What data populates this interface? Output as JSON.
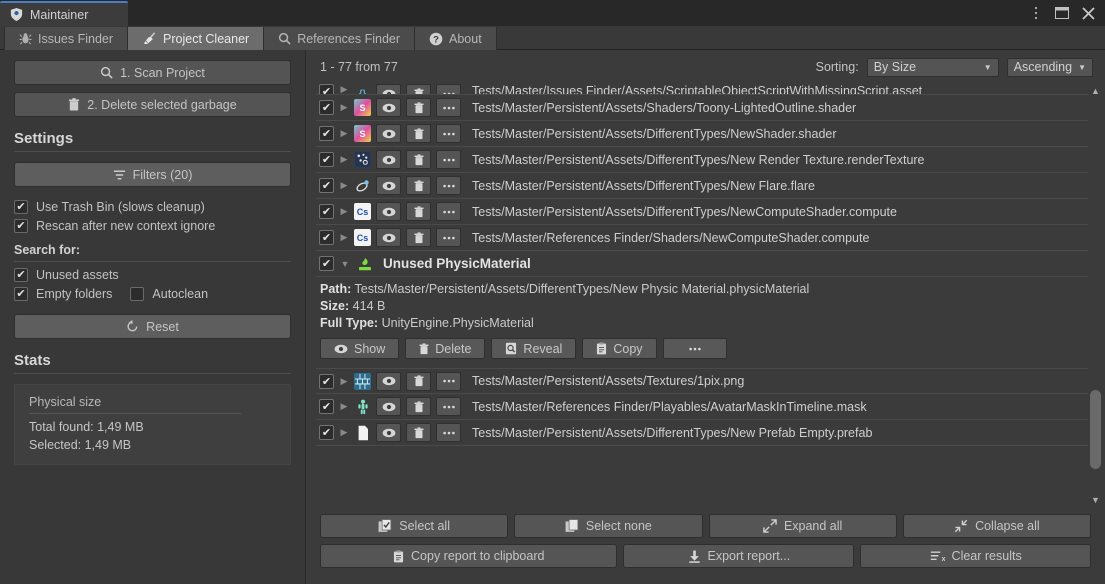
{
  "window": {
    "tab_title": "Maintainer",
    "controls": [
      {
        "name": "menu-icon",
        "glyph": "⋮"
      },
      {
        "name": "maximize-icon",
        "glyph": "❐"
      },
      {
        "name": "close-icon",
        "glyph": "✕"
      }
    ]
  },
  "toolbar": {
    "tabs": [
      {
        "label": "Issues Finder",
        "icon": "bug-icon",
        "active": false
      },
      {
        "label": "Project Cleaner",
        "icon": "broom-icon",
        "active": true
      },
      {
        "label": "References Finder",
        "icon": "search-icon",
        "active": false
      },
      {
        "label": "About",
        "icon": "question-icon",
        "active": false
      }
    ]
  },
  "sidebar": {
    "scan_button": "1. Scan Project",
    "delete_button": "2. Delete selected garbage",
    "settings_header": "Settings",
    "filters_button": "Filters (20)",
    "options": [
      {
        "label": "Use Trash Bin (slows cleanup)",
        "checked": true
      },
      {
        "label": "Rescan after new context ignore",
        "checked": true
      }
    ],
    "search_for_header": "Search for:",
    "search_options": [
      {
        "label": "Unused assets",
        "checked": true
      },
      {
        "label": "Empty folders",
        "checked": true
      },
      {
        "label": "Autoclean",
        "checked": false
      }
    ],
    "reset_button": "Reset",
    "stats_header": "Stats",
    "stats": {
      "title": "Physical size",
      "total_found": "Total found: 1,49 MB",
      "selected": "Selected: 1,49 MB"
    }
  },
  "results": {
    "count_label": "1 - 77 from 77",
    "sorting_label": "Sorting:",
    "sort_by": "By Size",
    "sort_order": "Ascending",
    "rows_top": [
      {
        "path": "Tests/Master/Issues Finder/Assets/ScriptableObjectScriptWithMissingScript.asset",
        "icon": "scriptable-object-icon",
        "icon_color": "#4aa3c8",
        "icon_text": "{}",
        "checked": true,
        "clipped": true
      },
      {
        "path": "Tests/Master/Persistent/Assets/Shaders/Toony-LightedOutline.shader",
        "icon": "shader-icon",
        "icon_color": "#7f4fb0",
        "icon_text": "S",
        "checked": true
      },
      {
        "path": "Tests/Master/Persistent/Assets/DifferentTypes/NewShader.shader",
        "icon": "shader-icon",
        "icon_color": "#7f4fb0",
        "icon_text": "S",
        "checked": true
      },
      {
        "path": "Tests/Master/Persistent/Assets/DifferentTypes/New Render Texture.renderTexture",
        "icon": "render-texture-icon",
        "icon_color": "#2a3a55",
        "icon_text": "▚",
        "checked": true
      },
      {
        "path": "Tests/Master/Persistent/Assets/DifferentTypes/New Flare.flare",
        "icon": "flare-icon",
        "icon_color": "#3b3b3b",
        "icon_text": "✦",
        "checked": true
      },
      {
        "path": "Tests/Master/Persistent/Assets/DifferentTypes/NewComputeShader.compute",
        "icon": "compute-shader-icon",
        "icon_color": "#f2f2f2",
        "icon_text": "Cs",
        "checked": true
      },
      {
        "path": "Tests/Master/References Finder/Shaders/NewComputeShader.compute",
        "icon": "compute-shader-icon",
        "icon_color": "#f2f2f2",
        "icon_text": "Cs",
        "checked": true
      }
    ],
    "expanded": {
      "title": "Unused PhysicMaterial",
      "icon": "physic-material-icon",
      "checked": true,
      "path_key": "Path:",
      "path_value": "Tests/Master/Persistent/Assets/DifferentTypes/New Physic Material.physicMaterial",
      "size_key": "Size:",
      "size_value": "414 B",
      "type_key": "Full Type:",
      "type_value": "UnityEngine.PhysicMaterial",
      "buttons": [
        {
          "label": "Show",
          "icon": "eye-icon"
        },
        {
          "label": "Delete",
          "icon": "trash-icon"
        },
        {
          "label": "Reveal",
          "icon": "reveal-icon"
        },
        {
          "label": "Copy",
          "icon": "clipboard-icon"
        },
        {
          "label": "",
          "icon": "more-icon"
        }
      ]
    },
    "rows_bottom": [
      {
        "path": "Tests/Master/Persistent/Assets/Textures/1pix.png",
        "icon": "texture-icon",
        "icon_color": "#2f6f8f",
        "icon_text": "▦",
        "checked": true
      },
      {
        "path": "Tests/Master/References Finder/Playables/AvatarMaskInTimeline.mask",
        "icon": "avatar-mask-icon",
        "icon_color": "#3b3b3b",
        "icon_text": "⚇",
        "checked": true
      },
      {
        "path": "Tests/Master/Persistent/Assets/DifferentTypes/New Prefab Empty.prefab",
        "icon": "prefab-icon",
        "icon_color": "#ffffff",
        "icon_text": "",
        "checked": true
      }
    ],
    "row_actions": [
      {
        "name": "show-icon",
        "title": "Show"
      },
      {
        "name": "delete-icon",
        "title": "Delete"
      },
      {
        "name": "more-icon",
        "title": "More"
      }
    ]
  },
  "bottom_buttons": {
    "row1": [
      {
        "label": "Select all",
        "icon": "select-all-icon"
      },
      {
        "label": "Select none",
        "icon": "select-none-icon"
      },
      {
        "label": "Expand all",
        "icon": "expand-icon"
      },
      {
        "label": "Collapse all",
        "icon": "collapse-icon"
      }
    ],
    "row2": [
      {
        "label": "Copy report to clipboard",
        "icon": "clipboard-icon"
      },
      {
        "label": "Export report...",
        "icon": "download-icon"
      },
      {
        "label": "Clear results",
        "icon": "clear-icon"
      }
    ]
  },
  "colors": {
    "accent": "#4a7ec0",
    "window_bg": "#383838",
    "panel_bg": "#3b3b3b",
    "button_bg": "#555555"
  }
}
